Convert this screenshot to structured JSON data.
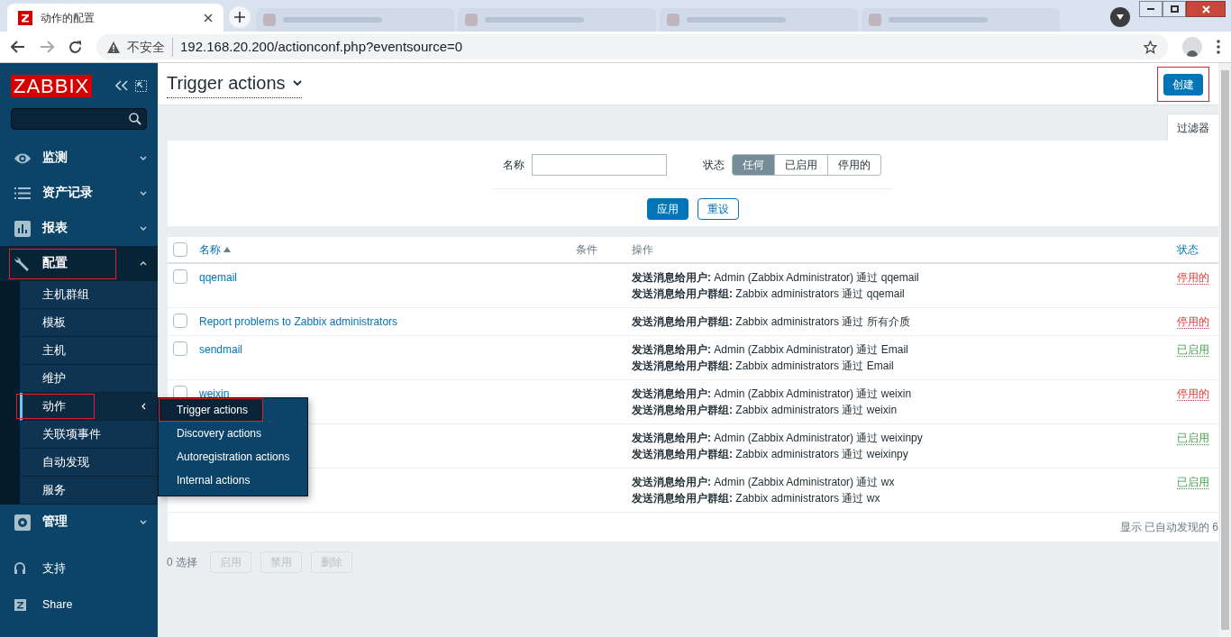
{
  "browser": {
    "tab": {
      "title": "动作的配置",
      "selected": true
    },
    "address_bar": {
      "security": "不安全",
      "url": "192.168.20.200/actionconf.php?eventsource=0"
    }
  },
  "sidebar": {
    "logo": "ZABBIX",
    "menu": [
      {
        "label": "监测",
        "kind": "eye",
        "expanded": false,
        "highlighted": false
      },
      {
        "label": "资产记录",
        "kind": "list",
        "expanded": false,
        "highlighted": false
      },
      {
        "label": "报表",
        "kind": "chart",
        "expanded": false,
        "highlighted": false
      },
      {
        "label": "配置",
        "kind": "wrench",
        "expanded": true,
        "highlighted": true,
        "children": [
          {
            "label": "主机群组",
            "selected": false,
            "highlighted": false
          },
          {
            "label": "模板",
            "selected": false,
            "highlighted": false
          },
          {
            "label": "主机",
            "selected": false,
            "highlighted": false
          },
          {
            "label": "维护",
            "selected": false,
            "highlighted": false
          },
          {
            "label": "动作",
            "selected": true,
            "highlighted": true
          },
          {
            "label": "关联项事件",
            "selected": false,
            "highlighted": false
          },
          {
            "label": "自动发现",
            "selected": false,
            "highlighted": false
          },
          {
            "label": "服务",
            "selected": false,
            "highlighted": false
          }
        ]
      },
      {
        "label": "管理",
        "kind": "gear",
        "expanded": false,
        "highlighted": false
      }
    ],
    "footer": [
      {
        "label": "支持",
        "kind": "headset"
      },
      {
        "label": "Share",
        "kind": "zlogo"
      }
    ]
  },
  "popup_menu": {
    "items": [
      {
        "label": "Trigger actions",
        "selected": true,
        "highlighted": true
      },
      {
        "label": "Discovery actions",
        "selected": false,
        "highlighted": false
      },
      {
        "label": "Autoregistration actions",
        "selected": false,
        "highlighted": false
      },
      {
        "label": "Internal actions",
        "selected": false,
        "highlighted": false
      }
    ]
  },
  "page": {
    "title": "Trigger actions",
    "create_button": {
      "label": "创建",
      "highlighted": true
    }
  },
  "filter": {
    "tab_label": "过滤器",
    "name_label": "名称",
    "status_label": "状态",
    "status_options": [
      {
        "label": "任何",
        "selected": true
      },
      {
        "label": "已启用",
        "selected": false
      },
      {
        "label": "停用的",
        "selected": false
      }
    ],
    "apply": "应用",
    "reset": "重设"
  },
  "table": {
    "select_all_checked": false,
    "columns": [
      "名称",
      "条件",
      "操作",
      "状态"
    ],
    "rows": [
      {
        "checked": false,
        "name": "qqemail",
        "operations": [
          "**发送消息给用户:** Admin (Zabbix Administrator) 通过 qqemail",
          "**发送消息给用户群组:** Zabbix administrators 通过 qqemail"
        ],
        "status": {
          "label": "停用的",
          "kind": "disabled"
        }
      },
      {
        "checked": false,
        "name": "Report problems to Zabbix administrators",
        "operations": [
          "**发送消息给用户群组:** Zabbix administrators 通过 所有介质"
        ],
        "status": {
          "label": "停用的",
          "kind": "disabled"
        }
      },
      {
        "checked": false,
        "name": "sendmail",
        "operations": [
          "**发送消息给用户:** Admin (Zabbix Administrator) 通过 Email",
          "**发送消息给用户群组:** Zabbix administrators 通过 Email"
        ],
        "status": {
          "label": "已启用",
          "kind": "enabled"
        }
      },
      {
        "checked": false,
        "name": "weixin",
        "operations": [
          "**发送消息给用户:** Admin (Zabbix Administrator) 通过 weixin",
          "**发送消息给用户群组:** Zabbix administrators 通过 weixin"
        ],
        "status": {
          "label": "停用的",
          "kind": "disabled"
        }
      },
      {
        "operations": [
          "**发送消息给用户:** Admin (Zabbix Administrator) 通过 weixinpy",
          "**发送消息给用户群组:** Zabbix administrators 通过 weixinpy"
        ],
        "status": {
          "label": "已启用",
          "kind": "enabled"
        }
      },
      {
        "operations": [
          "**发送消息给用户:** Admin (Zabbix Administrator) 通过 wx",
          "**发送消息给用户群组:** Zabbix administrators 通过 wx"
        ],
        "status": {
          "label": "已启用",
          "kind": "enabled"
        }
      }
    ],
    "summary": "显示 已自动发现的 6"
  },
  "selection": {
    "count": "0 选择",
    "buttons": [
      {
        "label": "启用",
        "disabled": true
      },
      {
        "label": "禁用",
        "disabled": true
      },
      {
        "label": "删除",
        "disabled": true
      }
    ]
  }
}
